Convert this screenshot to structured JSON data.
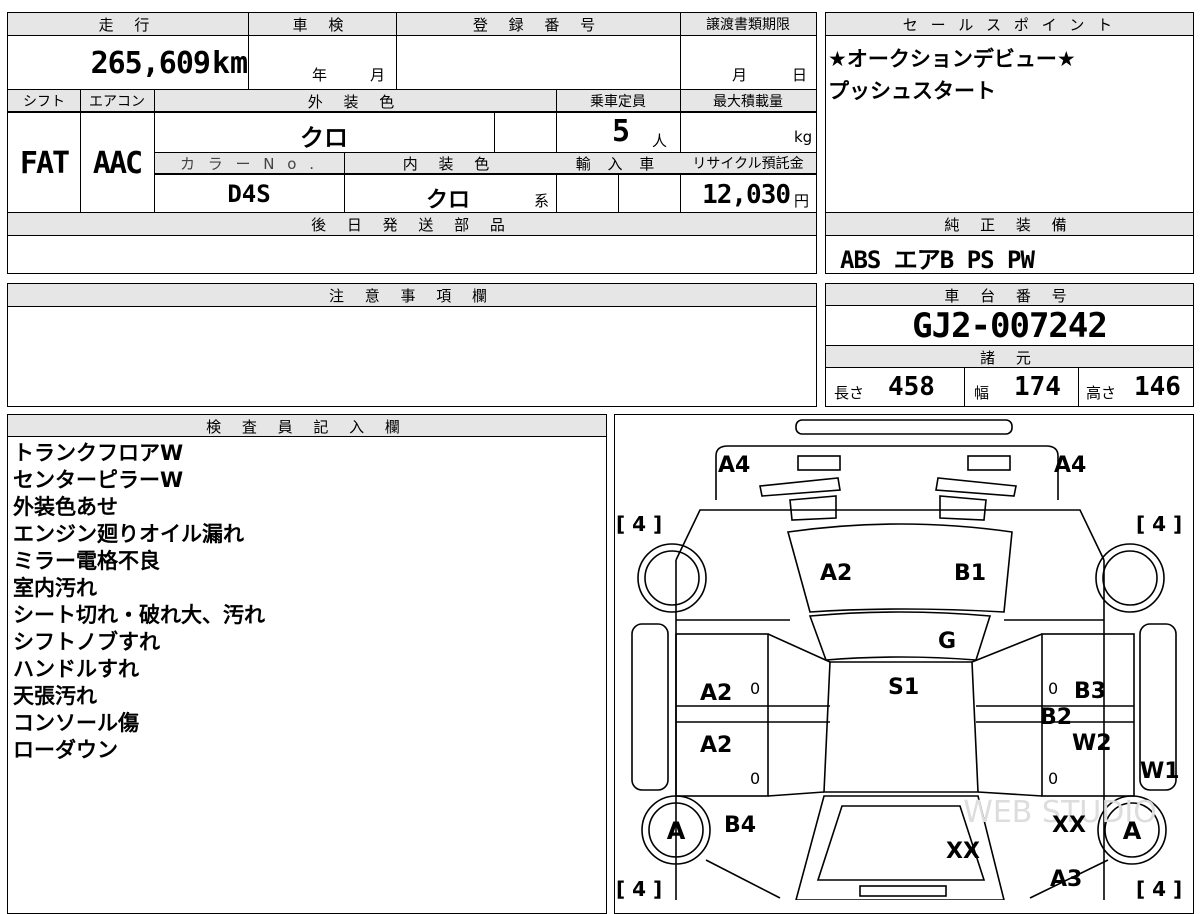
{
  "header": {
    "mileage_label": "走 行",
    "shaken_label": "車 検",
    "registration_label": "登 録 番 号",
    "transfer_deadline_label": "譲渡書類期限",
    "sales_points_label": "セ ー ル ス ポ イ ン ト"
  },
  "mileage": {
    "value": "265,609",
    "unit": "km"
  },
  "shaken": {
    "year_unit": "年",
    "month_unit": "月"
  },
  "transfer": {
    "month_unit": "月",
    "day_unit": "日"
  },
  "sales_points": {
    "lines": [
      "★オークションデビュー★",
      "プッシュスタート"
    ]
  },
  "specs": {
    "shift_label": "シフト",
    "aircon_label": "エアコン",
    "exterior_color_label": "外 装 色",
    "capacity_label": "乗車定員",
    "max_load_label": "最大積載量",
    "shift_value": "FAT",
    "aircon_value": "AAC",
    "exterior_color_value": "クロ",
    "capacity_value": "5",
    "capacity_unit": "人",
    "max_load_unit": "kg",
    "color_no_label": "カ ラ ー N o .",
    "interior_color_label": "内 装 色",
    "import_label": "輸 入 車",
    "recycle_label": "リサイクル預託金",
    "color_no_value": "D4S",
    "interior_color_value": "クロ",
    "interior_color_suffix": "系",
    "recycle_value": "12,030",
    "recycle_unit": "円"
  },
  "later_parts": {
    "label": "後 日 発 送 部 品"
  },
  "equipment": {
    "label": "純 正 装 備",
    "value": "ABS エアB PS PW"
  },
  "caution": {
    "label": "注 意 事 項 欄"
  },
  "chassis": {
    "label": "車 台 番 号",
    "value": "GJ2-007242"
  },
  "dimensions": {
    "label": "諸 元",
    "length_label": "長さ",
    "length_value": "458",
    "width_label": "幅",
    "width_value": "174",
    "height_label": "高さ",
    "height_value": "146"
  },
  "inspector": {
    "label": "検 査 員 記 入 欄",
    "notes": [
      "トランクフロアW",
      "センターピラーW",
      "外装色あせ",
      "エンジン廻りオイル漏れ",
      "ミラー電格不良",
      "室内汚れ",
      "シート切れ・破れ大、汚れ",
      "シフトノブすれ",
      "ハンドルすれ",
      "天張汚れ",
      "コンソール傷",
      "ローダウン"
    ]
  },
  "diagram": {
    "tire_marks": [
      "[ 4 ]",
      "[ 4 ]",
      "[ 4 ]",
      "[ 4 ]"
    ],
    "wheel_labels": [
      "A",
      "A"
    ],
    "marks": {
      "a4_left": "A4",
      "a4_right": "A4",
      "a2_hood": "A2",
      "b1_hood": "B1",
      "g_windshield": "G",
      "s1_roof": "S1",
      "a2_front_door": "A2",
      "a2_rear_door": "A2",
      "b3": "B3",
      "b2": "B2",
      "w2": "W2",
      "w1": "W1",
      "b4": "B4",
      "xx_trunk": "XX",
      "xx_right": "XX",
      "a3": "A3",
      "zero": "0"
    },
    "watermark": "WEB STUDIO"
  }
}
